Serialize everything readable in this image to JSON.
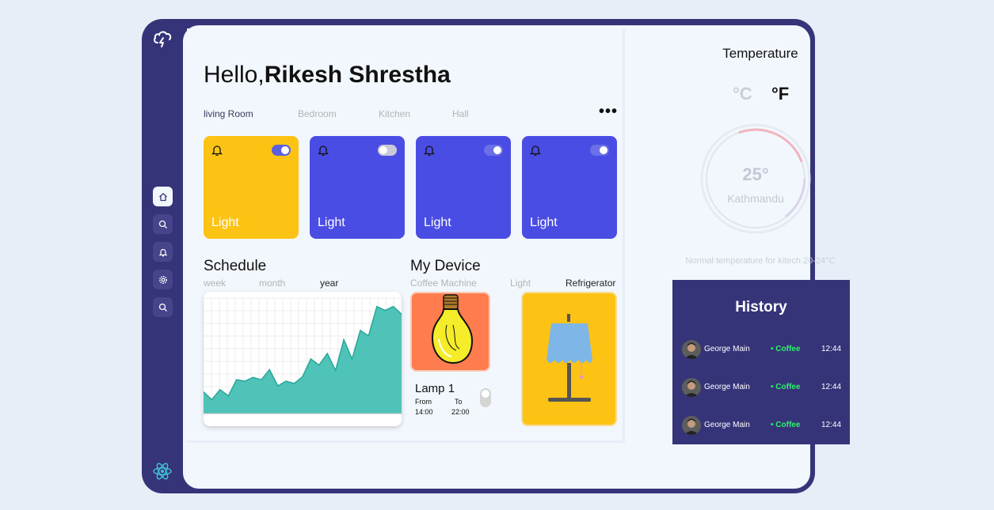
{
  "greeting": {
    "hello": "Hello,",
    "name": "Rikesh Shrestha"
  },
  "rooms": [
    {
      "label": "living Room",
      "active": true
    },
    {
      "label": "Bedroom",
      "active": false
    },
    {
      "label": "Kitchen",
      "active": false
    },
    {
      "label": "Hall",
      "active": false
    }
  ],
  "more_label": "•••",
  "devices_cards": [
    {
      "label": "Light",
      "toggle_on": true,
      "color": "#fdc314"
    },
    {
      "label": "Light",
      "toggle_on": false,
      "color": "#4a4de3"
    },
    {
      "label": "Light",
      "toggle_on": true,
      "color": "#4a4de3"
    },
    {
      "label": "Light",
      "toggle_on": true,
      "color": "#4a4de3"
    }
  ],
  "schedule": {
    "title": "Schedule",
    "tabs": [
      {
        "label": "week",
        "active": false
      },
      {
        "label": "month",
        "active": false
      },
      {
        "label": "year",
        "active": true
      }
    ]
  },
  "chart_data": {
    "type": "area",
    "title": "",
    "x": [
      1,
      2,
      3,
      4,
      5,
      6,
      7,
      8,
      9,
      10,
      11,
      12,
      13,
      14,
      15,
      16,
      17,
      18,
      19,
      20,
      21,
      22,
      23,
      24,
      25
    ],
    "values": [
      28,
      18,
      31,
      23,
      44,
      42,
      47,
      44,
      57,
      36,
      42,
      39,
      48,
      71,
      63,
      78,
      56,
      96,
      71,
      108,
      101,
      139,
      134,
      139,
      129
    ],
    "ylim": [
      0,
      150
    ],
    "color": "#4fc3b8",
    "grid": true
  },
  "my_device": {
    "title": "My Device",
    "tabs": [
      {
        "label": "Coffee Machine",
        "active": false
      },
      {
        "label": "Light",
        "active": false
      },
      {
        "label": "Refrigerator",
        "active": true
      }
    ],
    "lamp": {
      "name": "Lamp 1",
      "from_label": "From",
      "to_label": "To",
      "from_time": "14:00",
      "to_time": "22:00",
      "on": false
    }
  },
  "temperature": {
    "title": "Temperature",
    "unit_c": "°C",
    "unit_f": "°F",
    "selected_unit": "F",
    "value": "25°",
    "city": "Kathmandu",
    "note": "Normal temperature for kitech 20-24°C"
  },
  "history": {
    "title": "History",
    "entries": [
      {
        "name": "George Main",
        "item": "Coffee",
        "time": "12:44"
      },
      {
        "name": "George Main",
        "item": "Coffee",
        "time": "12:44"
      },
      {
        "name": "George Main",
        "item": "Coffee",
        "time": "12:44"
      }
    ]
  },
  "colors": {
    "sidebar": "#363479",
    "accent_yellow": "#fdc314",
    "accent_blue": "#4a4de3",
    "chart_fill": "#4fc3b8",
    "coffee_green": "#2df26b"
  },
  "sidebar_icons": [
    "cloud-bolt-icon",
    "home-icon",
    "search-icon",
    "bell-icon",
    "gear-icon",
    "search-icon",
    "react-icon"
  ]
}
